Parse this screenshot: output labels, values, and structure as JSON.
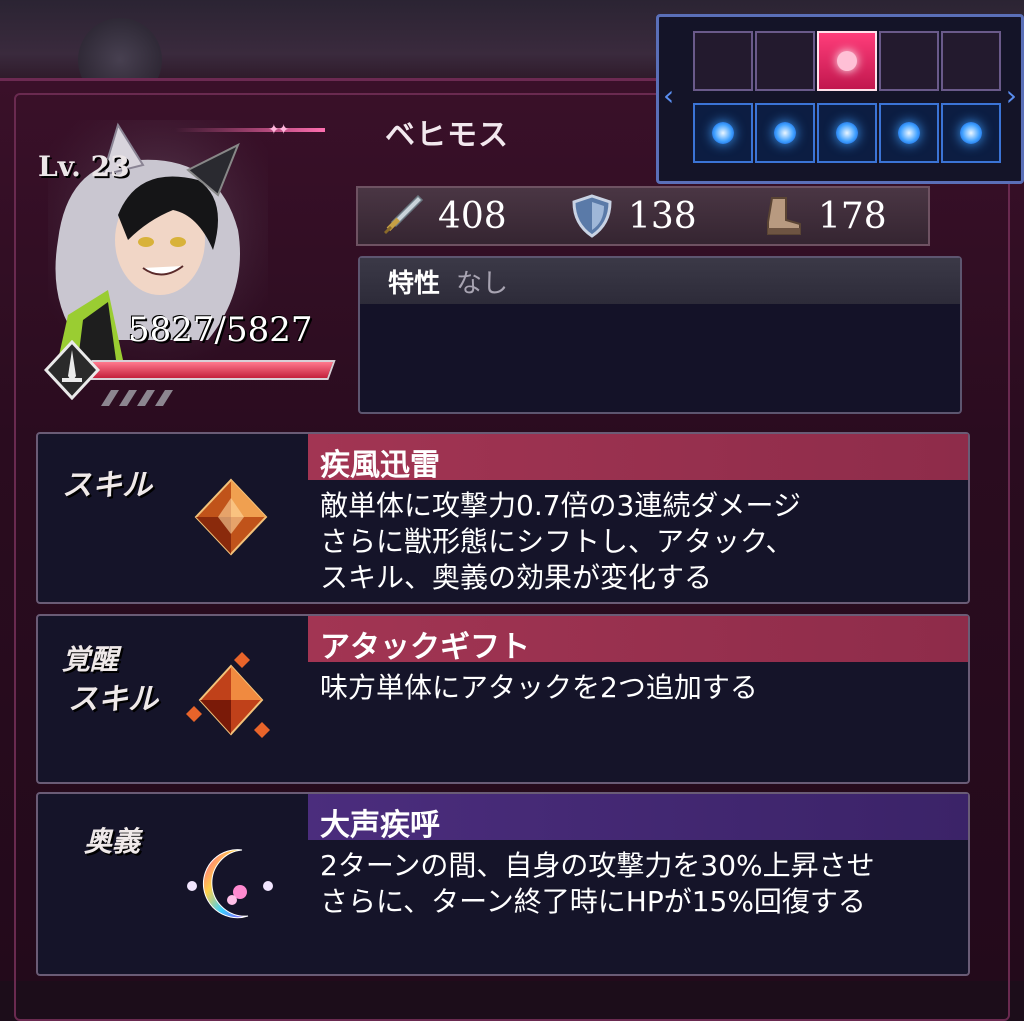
{
  "character": {
    "name": "ベヒモス",
    "level": "Lv. 23",
    "hp": "5827/5827",
    "hp_fraction": 1.0
  },
  "stats": {
    "attack": "408",
    "defense": "138",
    "speed": "178"
  },
  "trait": {
    "label": "特性",
    "value": "なし"
  },
  "skills": [
    {
      "kind": "スキル",
      "name": "疾風迅雷",
      "description": "敵単体に攻撃力0.7倍の3連続ダメージ\nさらに獣形態にシフトし、アタック、\nスキル、奥義の効果が変化する",
      "icon": "orange-crystal-icon"
    },
    {
      "kind_line1": "覚醒",
      "kind_line2": "スキル",
      "name": "アタックギフト",
      "description": "味方単体にアタックを2つ追加する",
      "icon": "awakened-crystal-icon"
    },
    {
      "kind": "奥義",
      "name": "大声疾呼",
      "description": "2ターンの間、自身の攻撃力を30%上昇させ\nさらに、ターン終了時にHPが15%回復する",
      "icon": "moon-orb-icon"
    }
  ],
  "formation": {
    "top_row": [
      "empty",
      "empty",
      "active",
      "empty",
      "empty"
    ],
    "bottom_row": [
      "filled",
      "filled",
      "filled",
      "filled",
      "filled"
    ]
  },
  "colors": {
    "skill_header": "#a23553",
    "ougi_header": "#4b2d7d",
    "hp_fill": "#c4203c",
    "active_cell": "#ff3d7a",
    "blue_dot": "#3fa0ff"
  }
}
